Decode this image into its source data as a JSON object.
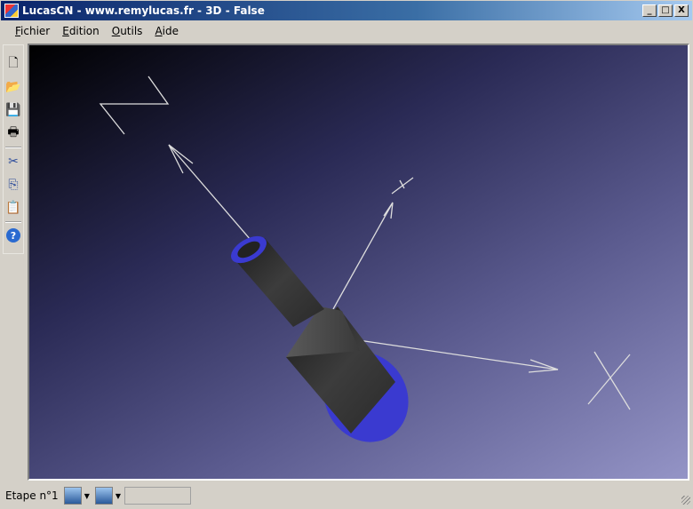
{
  "window": {
    "title": "LucasCN - www.remylucas.fr - 3D - False",
    "minimize": "_",
    "maximize": "□",
    "close": "X"
  },
  "menu": [
    {
      "key": "F",
      "rest": "ichier"
    },
    {
      "key": "E",
      "rest": "dition"
    },
    {
      "key": "O",
      "rest": "utils"
    },
    {
      "key": "A",
      "rest": "ide"
    }
  ],
  "toolbar": {
    "new": "🗋",
    "open": "📂",
    "save": "💾",
    "print": "🖶",
    "cut": "✂",
    "copy": "⎘",
    "paste": "📋",
    "help": "?"
  },
  "viewport": {
    "axes": [
      "X",
      "Y",
      "Z"
    ]
  },
  "status": {
    "step_label": "Etape n°1",
    "field_value": ""
  }
}
